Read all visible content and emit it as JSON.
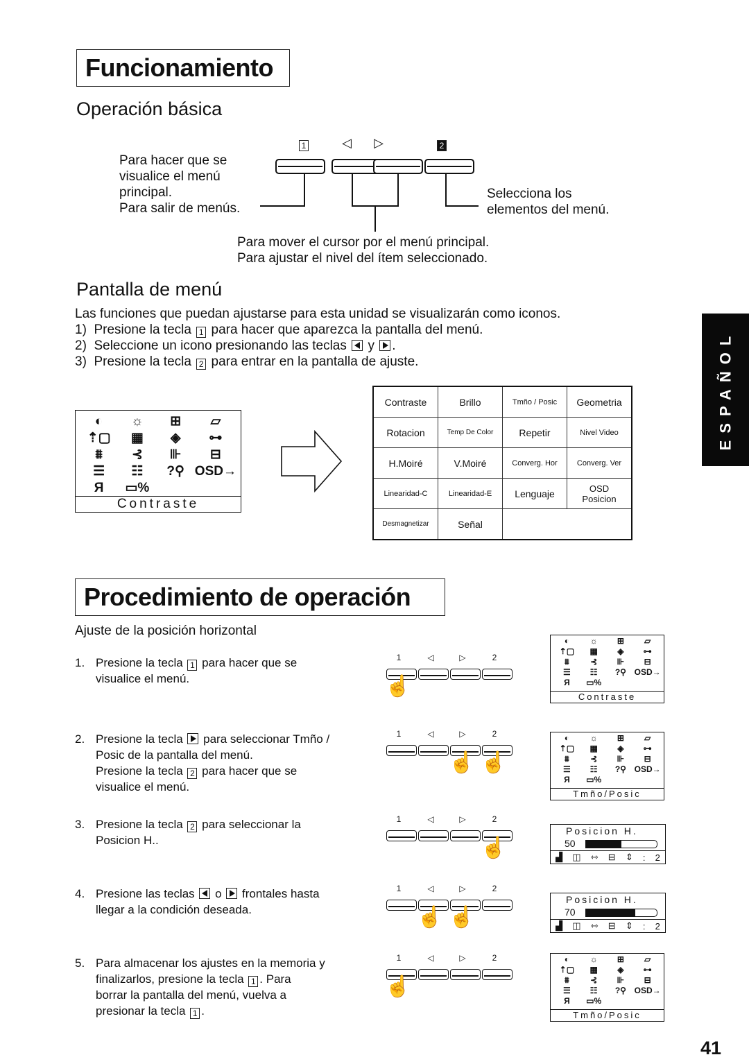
{
  "section1": {
    "title": "Funcionamiento",
    "basic": {
      "heading": "Operación básica",
      "keys": [
        "1",
        "◁",
        "▷",
        "2"
      ],
      "left_note": [
        "Para hacer que se",
        "visualice el menú",
        "principal.",
        "Para salir de menús."
      ],
      "right_note": [
        "Selecciona los",
        "elementos del menú."
      ],
      "bottom_note": [
        "Para mover el cursor por el menú principal.",
        "Para ajustar el nivel del ítem seleccionado."
      ]
    },
    "menu": {
      "heading": "Pantalla de menú",
      "intro": "Las funciones que puedan ajustarse para esta unidad se visualizarán como iconos.",
      "steps": [
        {
          "num": "1)",
          "pre": "Presione la tecla",
          "key": "1",
          "post": "para hacer que aparezca la pantalla del menú."
        },
        {
          "num": "2)",
          "pre": "Seleccione un icono presionando las teclas",
          "mid": "y",
          "post": "."
        },
        {
          "num": "3)",
          "pre": "Presione la tecla",
          "key": "2",
          "post": "para entrar en la pantalla de ajuste."
        }
      ],
      "osd_icons": [
        "◐",
        "☼",
        "⊞",
        "▱",
        "⇡▢",
        "▦",
        "◈",
        "⊶",
        "⩩",
        "⊰",
        "⊪",
        "⊟",
        "☰",
        "☷",
        "?⚲",
        "OSD→",
        "Я",
        "▭%"
      ],
      "osd_caption": "Contraste",
      "function_table": [
        [
          "Contraste",
          "Brillo",
          "Tmño / Posic",
          "Geometria"
        ],
        [
          "Rotacion",
          "Temp De Color",
          "Repetir",
          "Nivel Video"
        ],
        [
          "H.Moiré",
          "V.Moiré",
          "Converg. Hor",
          "Converg. Ver"
        ],
        [
          "Linearidad-C",
          "Linearidad-E",
          "Lenguaje",
          "OSD Posicion"
        ],
        [
          "Desmagnetizar",
          "Señal"
        ]
      ]
    }
  },
  "section2": {
    "title": "Procedimiento de operación",
    "subtitle": "Ajuste de la posición horizontal",
    "steps": [
      {
        "num": "1.",
        "lines": [
          "Presione la tecla [1] para hacer que se",
          "visualice el menú."
        ],
        "pressed": [
          0
        ],
        "screen": {
          "type": "menu",
          "caption": "Contraste"
        }
      },
      {
        "num": "2.",
        "lines": [
          "Presione la tecla [▶] para seleccionar Tmño /",
          "Posic de la pantalla del menú.",
          "Presione la tecla [2] para hacer que se",
          "visualice el menú."
        ],
        "pressed": [
          2,
          3
        ],
        "screen": {
          "type": "menu",
          "caption": "Tmño/Posic"
        }
      },
      {
        "num": "3.",
        "lines": [
          "Presione la tecla [2] para seleccionar la",
          "Posicion H.."
        ],
        "pressed": [
          3
        ],
        "screen": {
          "type": "slider",
          "label": "Posicion H.",
          "value": 50,
          "fraction": 0.5
        }
      },
      {
        "num": "4.",
        "lines": [
          "Presione las teclas [◀] o [▶] frontales hasta",
          "llegar a la condición deseada."
        ],
        "pressed": [
          1,
          2
        ],
        "screen": {
          "type": "slider",
          "label": "Posicion H.",
          "value": 70,
          "fraction": 0.7
        }
      },
      {
        "num": "5.",
        "lines": [
          "Para almacenar los ajustes en la memoria y",
          "finalizarlos, presione la tecla [1]. Para",
          "borrar la  pantalla del menú, vuelva a",
          "presionar la tecla [1]."
        ],
        "pressed": [
          0
        ],
        "screen": {
          "type": "menu",
          "caption": "Tmño/Posic"
        }
      }
    ],
    "slider_footer": [
      "▟",
      "◫",
      "⇿",
      "⊟",
      "⇕",
      ":",
      "2"
    ]
  },
  "side_tab": "ESPAÑOL",
  "page_number": "41"
}
